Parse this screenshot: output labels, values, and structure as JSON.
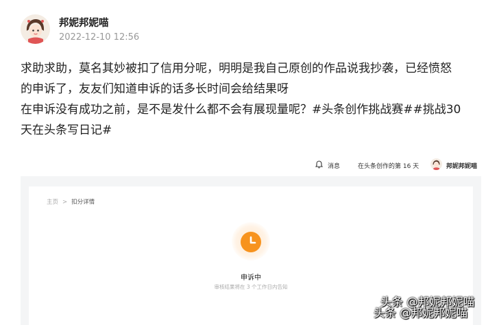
{
  "post": {
    "username": "邦妮邦妮喵",
    "timestamp": "2022-12-10 12:56",
    "body_line1": "求助求助，莫名其妙被扣了信用分呢，明明是我自己原创的作品说我抄袭，已经愤怒",
    "body_line2": "的申诉了，友友们知道申诉的话多长时间会给结果呀",
    "body_line3": "在申诉没有成功之前，是不是发什么都不会有展现量呢？#头条创作挑战赛##挑战30",
    "body_line4": "天在头条写日记#"
  },
  "embed": {
    "topbar": {
      "notify_label": "消息",
      "days_label": "在头条创作的第 16 天",
      "username": "邦妮邦妮喵"
    },
    "breadcrumb": {
      "home": "主页",
      "separator": ">",
      "current": "扣分详情"
    },
    "status": {
      "title": "申诉中",
      "subtitle": "审核结果将在 3 个工作日内告知"
    }
  },
  "watermark": {
    "line1": "头条 @邦妮邦妮喵",
    "line2": "头条 @邦妮邦妮喵"
  },
  "colors": {
    "accent_orange": "#f7931e",
    "embed_bg": "#f4f5f6"
  }
}
